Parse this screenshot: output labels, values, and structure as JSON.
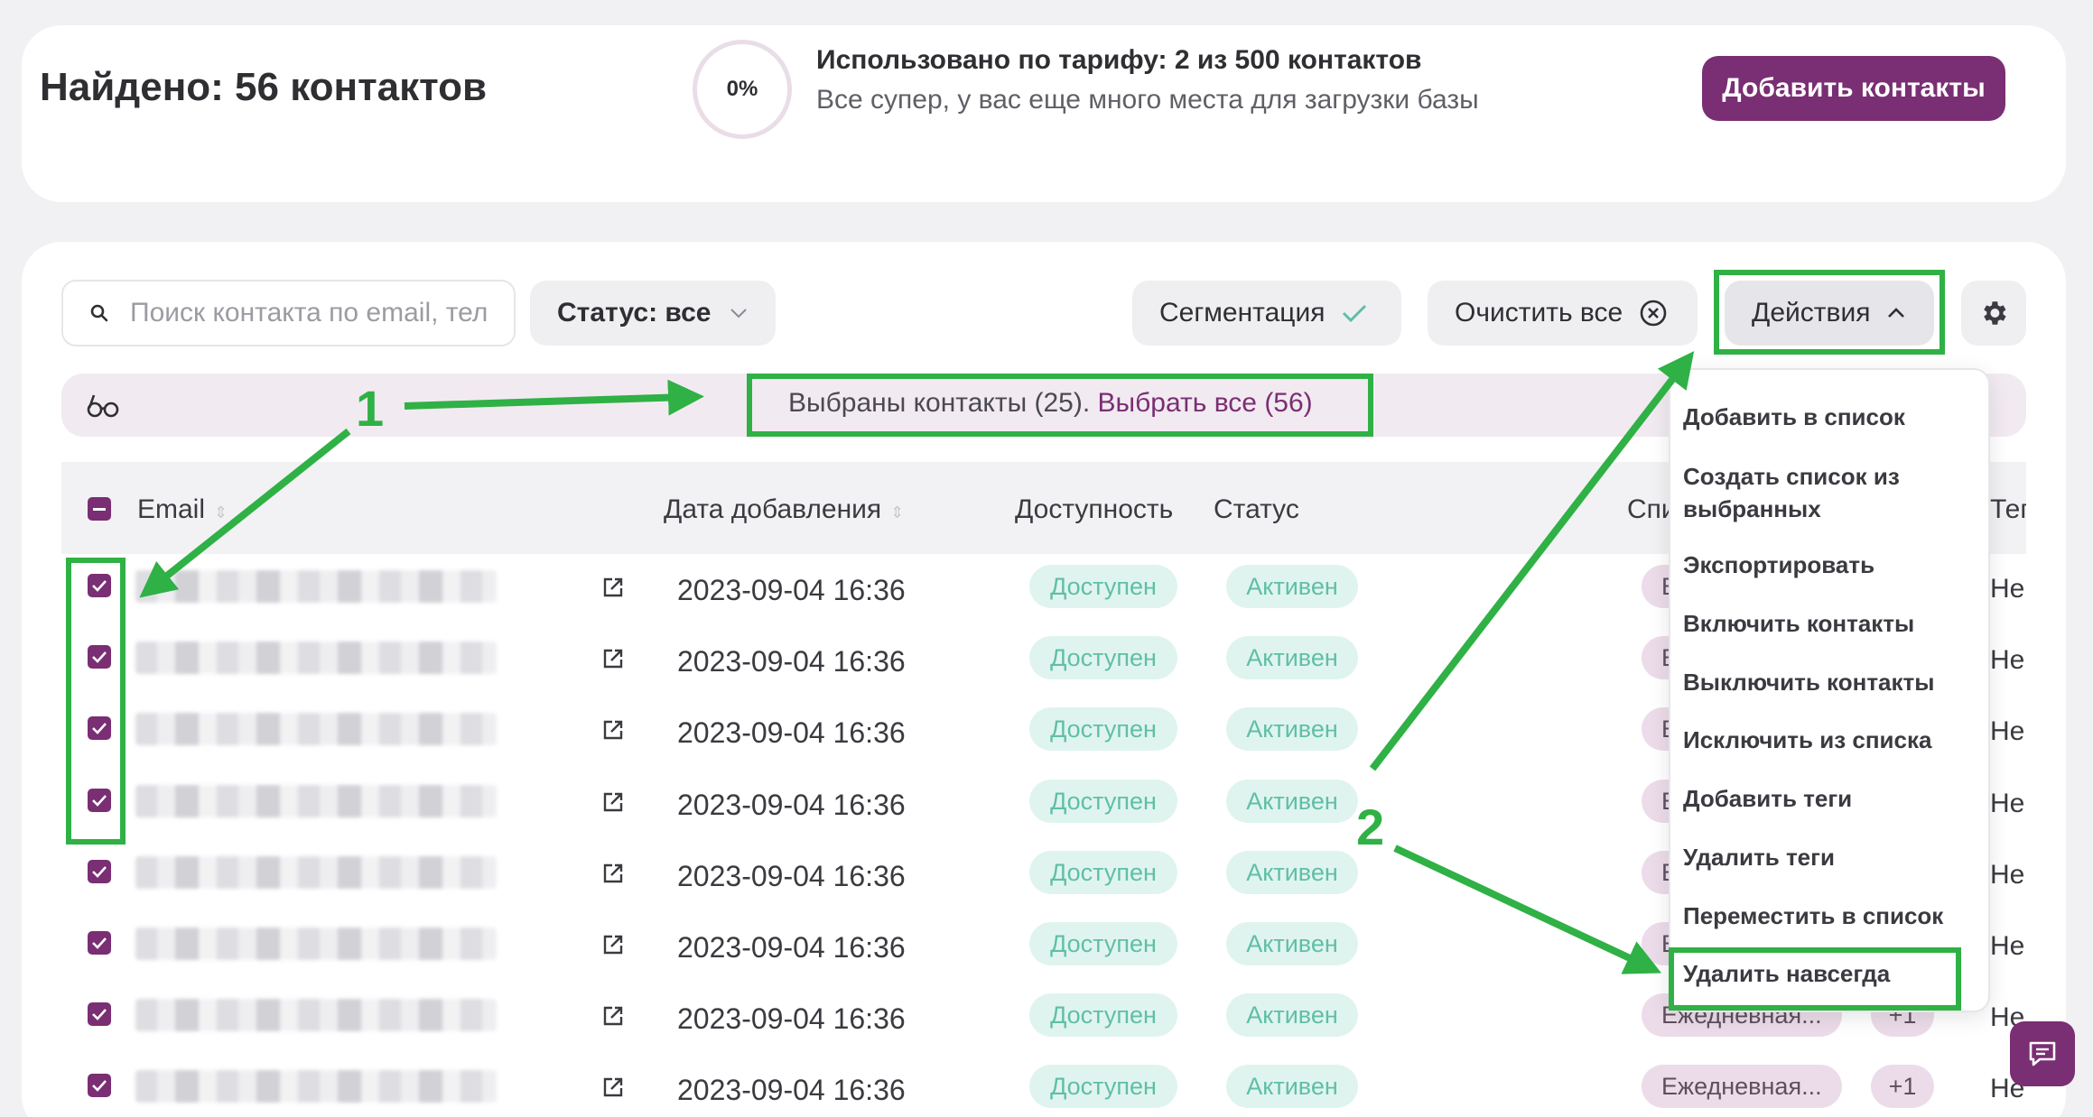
{
  "header": {
    "found_title": "Найдено: 56 контактов",
    "usage_percent": "0%",
    "usage_line1": "Использовано по тарифу: 2 из 500 контактов",
    "usage_line2": "Все супер, у вас еще много места для загрузки базы",
    "add_contacts_label": "Добавить контакты"
  },
  "toolbar": {
    "search_placeholder": "Поиск контакта по email, тел",
    "status_filter_label": "Статус: все",
    "segmentation_label": "Сегментация",
    "clear_all_label": "Очистить все",
    "actions_label": "Действия"
  },
  "selection": {
    "selected_text": "Выбраны контакты (25).",
    "select_all_link": "Выбрать все (56)"
  },
  "table": {
    "columns": {
      "email": "Email",
      "date_added": "Дата добавления",
      "availability": "Доступность",
      "status": "Статус",
      "lists_partial": "Спи",
      "tags_partial": "Теги"
    },
    "rows": [
      {
        "date": "2023-09-04 16:36",
        "availability": "Доступен",
        "status": "Активен",
        "list_partial": "Е",
        "tags_partial": "Не"
      },
      {
        "date": "2023-09-04 16:36",
        "availability": "Доступен",
        "status": "Активен",
        "list_partial": "Е",
        "tags_partial": "Не"
      },
      {
        "date": "2023-09-04 16:36",
        "availability": "Доступен",
        "status": "Активен",
        "list_partial": "Е",
        "tags_partial": "Не"
      },
      {
        "date": "2023-09-04 16:36",
        "availability": "Доступен",
        "status": "Активен",
        "list_partial": "Е",
        "tags_partial": "Не"
      },
      {
        "date": "2023-09-04 16:36",
        "availability": "Доступен",
        "status": "Активен",
        "list_partial": "Е",
        "tags_partial": "Не"
      },
      {
        "date": "2023-09-04 16:36",
        "availability": "Доступен",
        "status": "Активен",
        "list_partial": "Е",
        "tags_partial": "Не"
      },
      {
        "date": "2023-09-04 16:36",
        "availability": "Доступен",
        "status": "Активен",
        "list_partial": "Ежедневная...",
        "plus": "+1",
        "tags_partial": "Не"
      },
      {
        "date": "2023-09-04 16:36",
        "availability": "Доступен",
        "status": "Активен",
        "list_partial": "Ежедневная...",
        "plus": "+1",
        "tags_partial": "Не"
      }
    ]
  },
  "actions_menu": {
    "items": [
      "Добавить в список",
      "Создать список из выбранных",
      "Экспортировать",
      "Включить контакты",
      "Выключить контакты",
      "Исключить из списка",
      "Добавить теги",
      "Удалить теги",
      "Переместить в список",
      "Удалить навсегда"
    ]
  },
  "annotations": {
    "label_1": "1",
    "label_2": "2"
  },
  "colors": {
    "accent": "#7a2e73",
    "annotation_green": "#2fb145",
    "badge_bg": "#e0f4ef",
    "badge_text": "#5fbfa6"
  }
}
